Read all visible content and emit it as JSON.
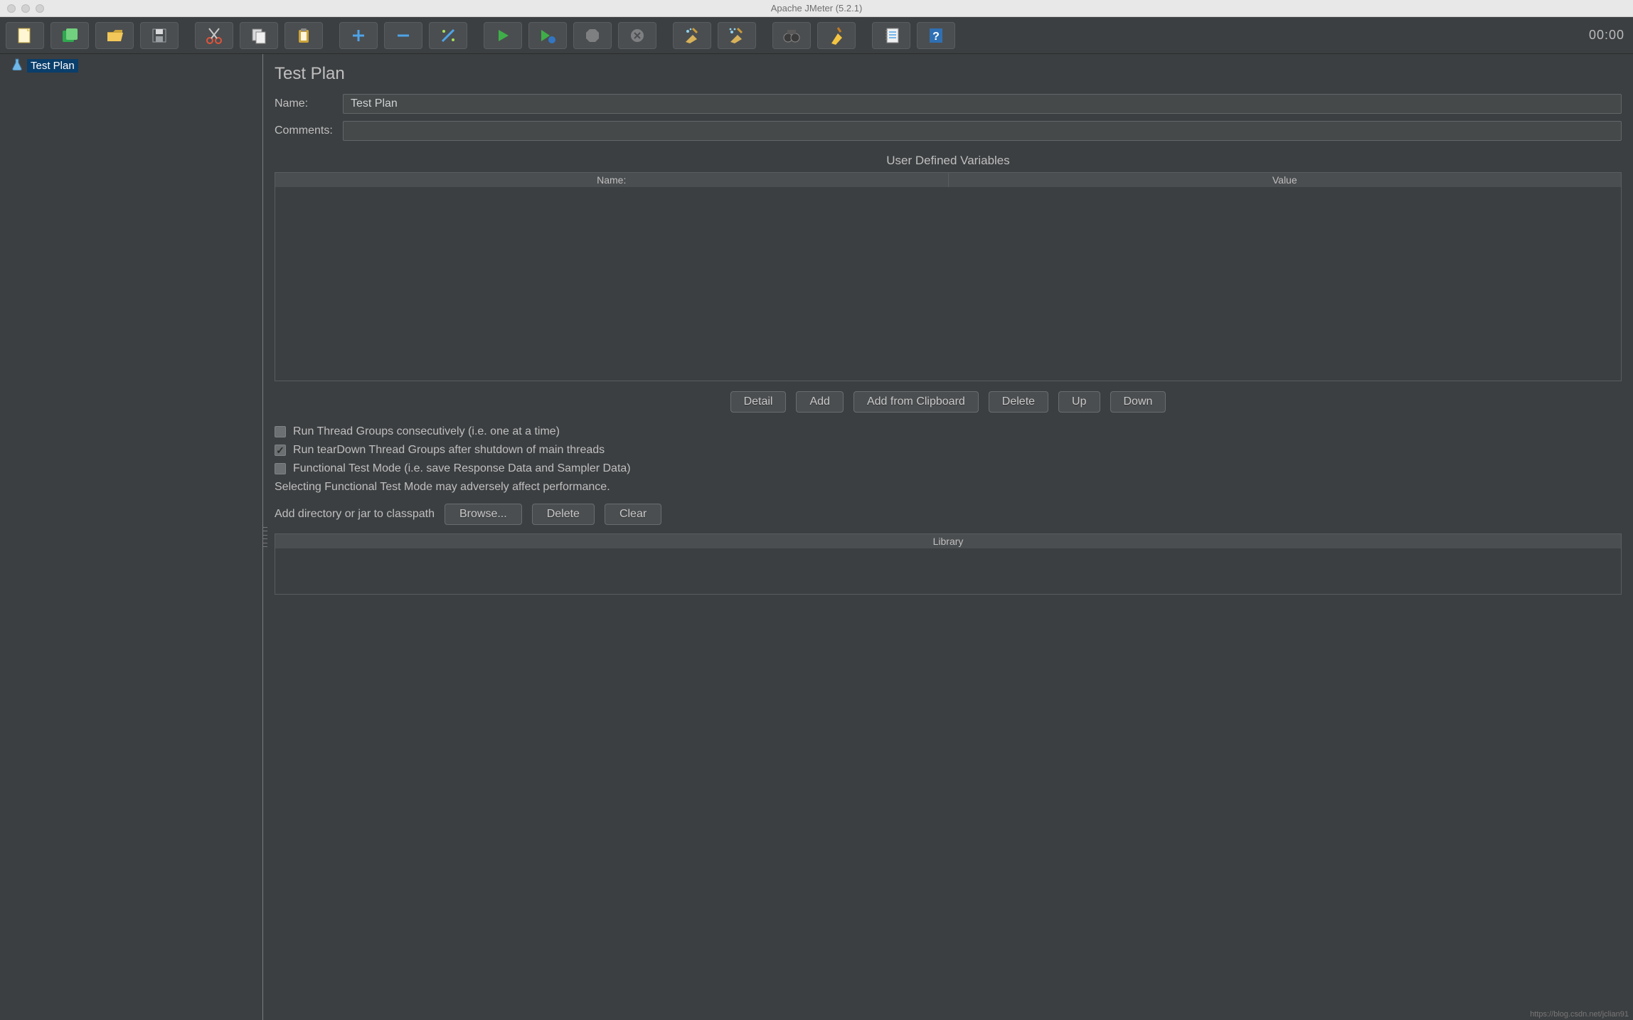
{
  "window": {
    "title": "Apache JMeter (5.2.1)"
  },
  "toolbar": {
    "timer": "00:00",
    "groups": [
      [
        "new",
        "templates",
        "open",
        "save"
      ],
      [
        "cut",
        "copy",
        "paste"
      ],
      [
        "plus",
        "minus",
        "wand"
      ],
      [
        "start",
        "start-no-pause",
        "stop",
        "shutdown"
      ],
      [
        "clear",
        "clear-all"
      ],
      [
        "search",
        "reset-search"
      ],
      [
        "fn-mode",
        "help"
      ]
    ]
  },
  "tree": {
    "root_label": "Test Plan"
  },
  "panel": {
    "title": "Test Plan",
    "name_label": "Name:",
    "name_value": "Test Plan",
    "comments_label": "Comments:",
    "comments_value": "",
    "udv": {
      "title": "User Defined Variables",
      "col_name": "Name:",
      "col_value": "Value"
    },
    "buttons": {
      "detail": "Detail",
      "add": "Add",
      "add_clip": "Add from Clipboard",
      "delete": "Delete",
      "up": "Up",
      "down": "Down"
    },
    "checks": {
      "consecutive": "Run Thread Groups consecutively (i.e. one at a time)",
      "teardown": "Run tearDown Thread Groups after shutdown of main threads",
      "functional": "Functional Test Mode (i.e. save Response Data and Sampler Data)",
      "consecutive_checked": false,
      "teardown_checked": true,
      "functional_checked": false
    },
    "functional_note": "Selecting Functional Test Mode may adversely affect performance.",
    "classpath": {
      "label": "Add directory or jar to classpath",
      "browse": "Browse...",
      "delete": "Delete",
      "clear": "Clear",
      "library_col": "Library"
    }
  },
  "watermark": "https://blog.csdn.net/jclian91"
}
